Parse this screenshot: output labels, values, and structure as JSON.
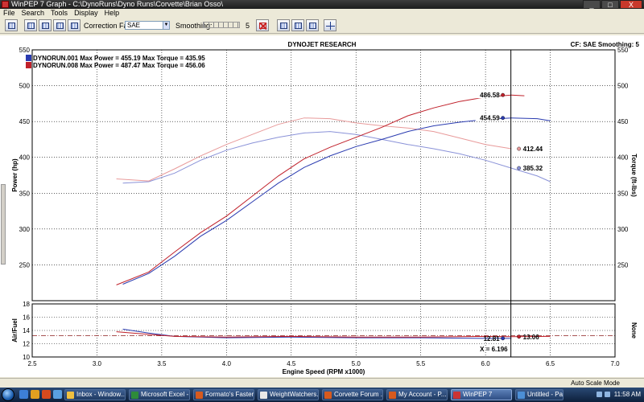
{
  "window": {
    "app_name": "WinPEP 7",
    "title": "WinPEP 7    Graph - C:\\DynoRuns\\Dyno Runs\\Corvette\\Brian Osso\\",
    "min_label": "_",
    "max_label": "□",
    "close_label": "X"
  },
  "menu": {
    "items": [
      "File",
      "Search",
      "Tools",
      "Display",
      "Help"
    ]
  },
  "toolbar": {
    "correction_factor_label": "Correction Factor:",
    "correction_factor_value": "SAE",
    "smoothing_label": "Smoothing:",
    "smoothing_value": "5"
  },
  "graph": {
    "header": "DYNOJET RESEARCH",
    "cf_info": "CF: SAE  Smoothing: 5",
    "legend": [
      {
        "label": "DYNORUN.001 Max Power = 455.19 Max Torque = 435.95",
        "color": "#2a3bb0"
      },
      {
        "label": "DYNORUN.008 Max Power = 487.47 Max Torque = 456.06",
        "color": "#c0202a"
      }
    ],
    "y_left_label": "Power (hp)",
    "y_right_label": "Torque (ft-lbs)",
    "x_label": "Engine Speed (RPM x1000)",
    "af_label": "Air/Fuel",
    "none_label": "None",
    "cursor_label": "X = 6.196",
    "markers": {
      "power_008": "486.58",
      "power_001": "454.59",
      "torque_008": "412.44",
      "torque_001": "385.32",
      "af_001": "12.81",
      "af_008": "13.06"
    }
  },
  "chart_data": {
    "type": "line",
    "xlabel": "Engine Speed (RPM x1000)",
    "xlim": [
      2.5,
      7.0
    ],
    "x_ticks": [
      "2.5",
      "3.0",
      "3.5",
      "4.0",
      "4.5",
      "5.0",
      "5.5",
      "6.0",
      "6.5",
      "7.0"
    ],
    "ylabel": "Power (hp)",
    "ylim": [
      200,
      550
    ],
    "y_ticks": [
      "250",
      "300",
      "350",
      "400",
      "450",
      "500",
      "550"
    ],
    "y2label": "Torque (ft-lbs)",
    "y2lim": [
      200,
      550
    ],
    "y2_ticks": [
      "250",
      "300",
      "350",
      "400",
      "450",
      "500",
      "550"
    ],
    "af_ylabel": "Air/Fuel",
    "af_ylim": [
      10,
      18
    ],
    "af_ticks": [
      "10",
      "12",
      "14",
      "16",
      "18"
    ],
    "grid": true,
    "legend_position": "top-left",
    "cursor_x": 6.196,
    "power_series": [
      {
        "name": "DYNORUN.001",
        "color": "#2a3bb0",
        "x": [
          3.2,
          3.4,
          3.6,
          3.8,
          4.0,
          4.2,
          4.4,
          4.6,
          4.8,
          5.0,
          5.2,
          5.4,
          5.6,
          5.8,
          6.0,
          6.2,
          6.4,
          6.5
        ],
        "y": [
          223,
          238,
          262,
          290,
          312,
          338,
          364,
          386,
          402,
          415,
          425,
          436,
          444,
          449,
          453,
          455,
          454,
          451
        ]
      },
      {
        "name": "DYNORUN.008",
        "color": "#c0202a",
        "x": [
          3.15,
          3.4,
          3.6,
          3.8,
          4.0,
          4.2,
          4.4,
          4.6,
          4.8,
          5.0,
          5.2,
          5.4,
          5.6,
          5.8,
          6.0,
          6.2,
          6.3
        ],
        "y": [
          222,
          240,
          268,
          295,
          318,
          346,
          374,
          398,
          414,
          428,
          442,
          458,
          469,
          478,
          484,
          487,
          486
        ]
      }
    ],
    "torque_series": [
      {
        "name": "DYNORUN.001",
        "color": "#8a92d8",
        "x": [
          3.2,
          3.4,
          3.6,
          3.8,
          4.0,
          4.2,
          4.4,
          4.6,
          4.8,
          5.0,
          5.2,
          5.4,
          5.6,
          5.8,
          6.0,
          6.2,
          6.4,
          6.5
        ],
        "y": [
          364,
          366,
          378,
          396,
          410,
          420,
          428,
          434,
          436,
          432,
          425,
          418,
          412,
          405,
          396,
          385,
          374,
          366
        ]
      },
      {
        "name": "DYNORUN.008",
        "color": "#e89a9a",
        "x": [
          3.15,
          3.4,
          3.6,
          3.8,
          4.0,
          4.2,
          4.4,
          4.6,
          4.8,
          5.0,
          5.2,
          5.4,
          5.6,
          5.8,
          6.0,
          6.2
        ],
        "y": [
          370,
          367,
          384,
          402,
          418,
          432,
          446,
          455,
          454,
          448,
          444,
          441,
          436,
          427,
          418,
          412
        ]
      }
    ],
    "af_series": [
      {
        "name": "DYNORUN.001",
        "color": "#2a3bb0",
        "x": [
          3.2,
          3.4,
          3.6,
          4.0,
          4.5,
          5.0,
          5.5,
          6.0,
          6.2
        ],
        "y": [
          14.2,
          13.6,
          13.1,
          12.9,
          13.0,
          12.9,
          12.9,
          12.8,
          12.8
        ]
      },
      {
        "name": "DYNORUN.008",
        "color": "#c0202a",
        "x": [
          3.15,
          3.4,
          3.6,
          4.0,
          4.5,
          5.0,
          5.5,
          6.0,
          6.2,
          6.5
        ],
        "y": [
          13.8,
          13.4,
          13.1,
          13.0,
          13.1,
          13.0,
          13.0,
          13.1,
          13.06,
          13.1
        ]
      }
    ]
  },
  "statusbar": {
    "text": "Auto Scale Mode"
  },
  "taskbar": {
    "items": [
      {
        "label": "Inbox - Window...",
        "color": "#f0c040"
      },
      {
        "label": "Microsoft Excel - ...",
        "color": "#2e8b3a"
      },
      {
        "label": "Formato's Faster...",
        "color": "#d65a1e"
      },
      {
        "label": "WeightWatchers...",
        "color": "#e8e8e8"
      },
      {
        "label": "Corvette Forum ...",
        "color": "#d65a1e"
      },
      {
        "label": "My Account - P...",
        "color": "#d65a1e"
      },
      {
        "label": "WinPEP 7",
        "color": "#c33"
      },
      {
        "label": "Untitled - Paint",
        "color": "#4c8fd6"
      }
    ],
    "clock": "11:58 AM"
  }
}
